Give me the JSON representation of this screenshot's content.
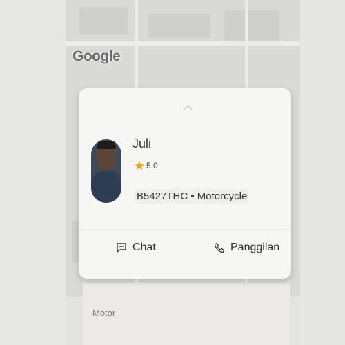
{
  "map": {
    "brand": "Google"
  },
  "driver": {
    "name": "Juli",
    "rating": "5.0",
    "vehicle": "B5427THC • Motorcycle"
  },
  "actions": {
    "chat_label": "Chat",
    "call_label": "Panggilan"
  },
  "footer": {
    "service_type": "Motor"
  },
  "colors": {
    "star": "#f2a51a",
    "card": "#f6f6f5"
  }
}
